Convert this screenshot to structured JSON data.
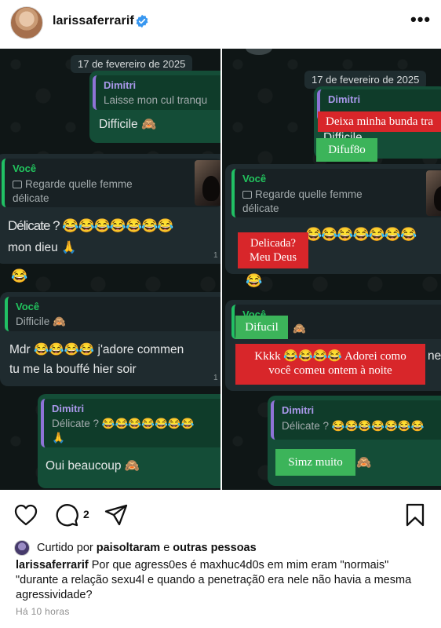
{
  "header": {
    "username": "larissaferrarif",
    "more_label": "•••"
  },
  "post": {
    "left": {
      "date": "17 de fevereiro de 2025",
      "b1_quote_name": "Dimitri",
      "b1_quote_text": "Laisse mon cul tranqu",
      "b1_text": "Difficile 🙈",
      "b2_quote_name": "Você",
      "b2_quote_line1": "Regarde quelle femme",
      "b2_quote_line2": "délicate",
      "b2_text1": "Délicate ? 😂😂😂😂😂😂😂",
      "b2_text2": "mon dieu 🙏",
      "b2_meta": "1",
      "lone_emoji": "😂",
      "b3_quote_name": "Você",
      "b3_quote_text": "Difficile 🙈",
      "b3_text1": "Mdr 😂😂😂😂 j'adore commen",
      "b3_text2": "tu me la bouffé hier soir",
      "b3_meta": "1",
      "b4_quote_name": "Dimitri",
      "b4_quote_text1": "Délicate ? 😂😂😂😂😂😂😂",
      "b4_quote_text2": "🙏",
      "b4_text": "Oui beaucoup 🙈"
    },
    "right": {
      "date": "17 de fevereiro de 2025",
      "b1_quote_name": "Dimitri",
      "b1_text_partial": "Difficile",
      "b2_quote_name": "Você",
      "b2_quote_line1": "Regarde quelle femme",
      "b2_quote_line2": "délicate",
      "b2_text": "😂😂😂😂😂😂😂",
      "lone_emoji": "😂",
      "b3_quote_name": "Você",
      "b3_quote_emoji": "🙈",
      "b3_tail": "ner",
      "b4_quote_name": "Dimitri",
      "b4_quote_text": "Délicate ? 😂😂😂😂😂😂😂",
      "b4_emoji": "🙈"
    },
    "overlays": {
      "o1": "Deixa minha bunda tra",
      "o2": "Difuf8o",
      "o3_line1": "Delicada?",
      "o3_line2": "Meu Deus",
      "o4": "Difucil",
      "o5_line1": "Kkkk 😂😂😂😂 Adorei como",
      "o5_line2": "você comeu ontem à noite",
      "o6": "Simz muito"
    }
  },
  "actions": {
    "comment_count": "2"
  },
  "likes": {
    "prefix": "Curtido por ",
    "user": "paisoltaram",
    "middle": " e ",
    "others": "outras pessoas"
  },
  "caption": {
    "user": "larissaferrarif",
    "text": " Por que agress0es é maxhuc4d0s em mim eram \"normais\" \"durante a relação sexu4l e quando a penetraçã0 era nele não havia a mesma agressividade?"
  },
  "timestamp": "Há 10 horas",
  "colors": {
    "chat_bg": "#0f1616",
    "bubble_out": "#144d37",
    "bubble_in": "#1f2b2f",
    "overlay_red": "#d8262a",
    "overlay_green": "#3cb45a",
    "verified_blue": "#3897f0"
  },
  "icons": [
    "verified-badge",
    "more-icon",
    "heart-icon",
    "comment-icon",
    "share-icon",
    "bookmark-icon"
  ]
}
